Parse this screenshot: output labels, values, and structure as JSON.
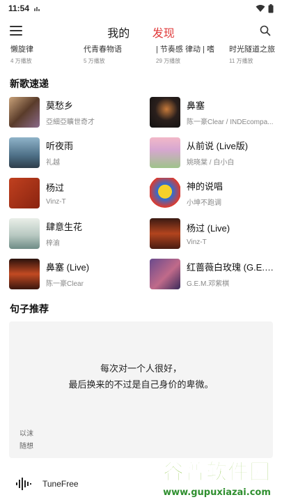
{
  "status_bar": {
    "time": "11:54"
  },
  "header": {
    "tabs": [
      {
        "label": "我的",
        "active": false
      },
      {
        "label": "发现",
        "active": true
      }
    ],
    "accent_color": "#e03a3a"
  },
  "playlists": [
    {
      "title": "懒旋律",
      "plays": "4 万播放"
    },
    {
      "title": "代青春物语",
      "plays": "5 万播放"
    },
    {
      "title": "| 节奏感 律动 | 嗜",
      "plays": "29 万播放"
    },
    {
      "title": "时光隧道之旅",
      "plays": "11 万播放"
    }
  ],
  "new_songs": {
    "title": "新歌速递",
    "items": [
      {
        "title": "莫愁乡",
        "artist": "亞細亞曠世奇才"
      },
      {
        "title": "鼻塞",
        "artist": "陈一豪Clear / INDEcompa..."
      },
      {
        "title": "听夜雨",
        "artist": "礼越"
      },
      {
        "title": "从前说 (Live版)",
        "artist": "姚晓棠 / 白小白"
      },
      {
        "title": "杨过",
        "artist": "Vinz-T"
      },
      {
        "title": "神的说唱",
        "artist": "小坤不跑调"
      },
      {
        "title": "肆意生花",
        "artist": "梓渝"
      },
      {
        "title": "杨过 (Live)",
        "artist": "Vinz-T"
      },
      {
        "title": "鼻塞 (Live)",
        "artist": "陈一豪Clear"
      },
      {
        "title": "红蔷薇白玫瑰 (G.E.M....",
        "artist": "G.E.M.邓紫棋"
      }
    ]
  },
  "quote_section": {
    "title": "句子推荐",
    "line1": "每次对一个人很好，",
    "line2": "最后换来的不过是自己身价的卑微。",
    "author": "以沫",
    "source": "随想"
  },
  "player": {
    "title": "TuneFree"
  },
  "watermark": {
    "main": "谷普软件园",
    "url": "www.gupuxiazai.com"
  }
}
